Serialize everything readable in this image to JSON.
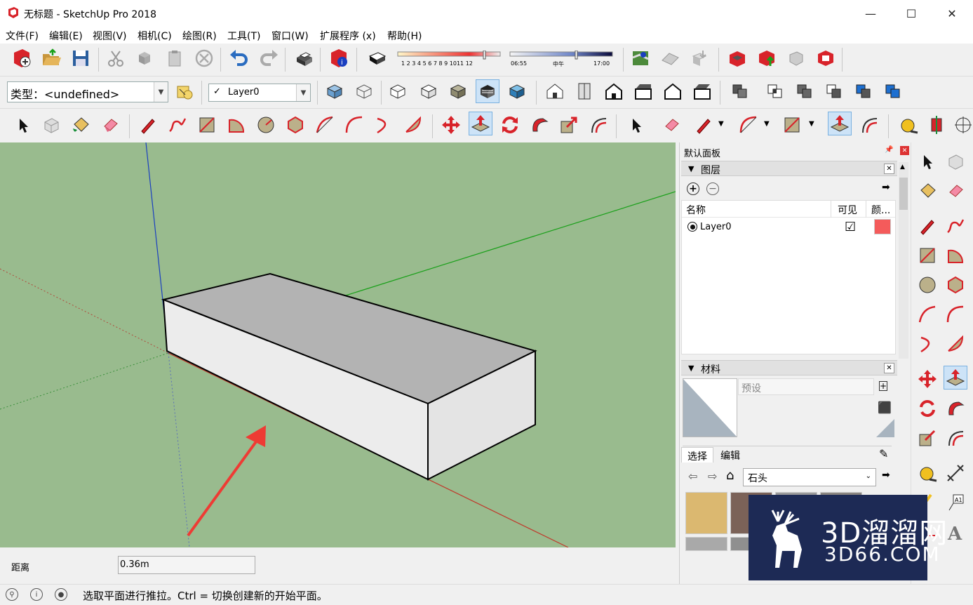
{
  "window": {
    "title": "无标题 - SketchUp Pro 2018",
    "minimize": "—",
    "maximize": "☐",
    "close": "✕"
  },
  "menu": [
    "文件(F)",
    "编辑(E)",
    "视图(V)",
    "相机(C)",
    "绘图(R)",
    "工具(T)",
    "窗口(W)",
    "扩展程序 (x)",
    "帮助(H)"
  ],
  "shadow": {
    "months": [
      "1",
      "2",
      "3",
      "4",
      "5",
      "6",
      "7",
      "8",
      "9",
      "10",
      "11",
      "12"
    ],
    "time_start": "06:55",
    "time_mid": "中午",
    "time_end": "17:00"
  },
  "style_select": {
    "label": "类型：<undefined>"
  },
  "layer_select": {
    "check": "✓",
    "value": "Layer0"
  },
  "tray": {
    "title": "默认面板",
    "pin": "📌",
    "close": "✕",
    "layers": {
      "header": "图层",
      "col_name": "名称",
      "col_visible": "可见",
      "col_color": "颜...",
      "row_name": "Layer0",
      "row_visible": "☑",
      "row_color": "#f45b5b"
    },
    "materials": {
      "header": "材料",
      "name_placeholder": "预设",
      "tab_select": "选择",
      "tab_edit": "编辑",
      "category": "石头"
    }
  },
  "measure": {
    "label": "距离",
    "value": "0.36m"
  },
  "status": {
    "hint": "选取平面进行推拉。Ctrl = 切换创建新的开始平面。"
  },
  "watermark": {
    "title": "3D溜溜网",
    "sub": "3D66.COM"
  },
  "colors": {
    "viewport_bg": "#99bb8e",
    "box_top": "#b3b3b3",
    "box_side": "#ececec",
    "arrow": "#ee3b34",
    "axis_red": "#c0392b",
    "axis_green": "#1aa01a",
    "axis_blue": "#1a3fc0"
  }
}
